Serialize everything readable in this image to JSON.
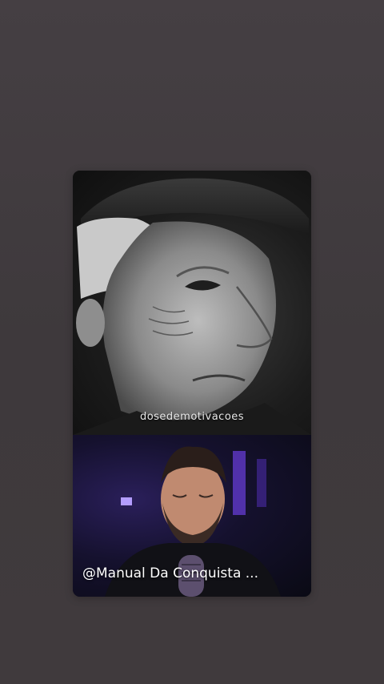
{
  "video": {
    "watermark": "dosedemotivacoes",
    "caption": "@Manual Da Conquista ..."
  },
  "colors": {
    "background": "#3f3a3d",
    "accent_purple": "#7a4cff"
  },
  "icons": {
    "microphone": "microphone-icon"
  }
}
